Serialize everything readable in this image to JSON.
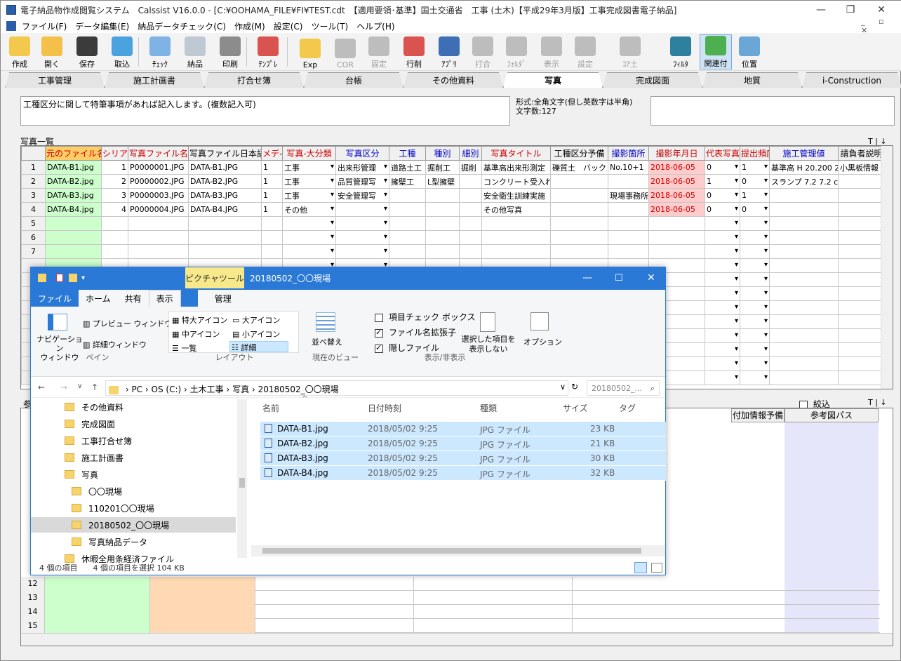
{
  "app": {
    "title": "電子納品物作成閲覧システム　Calssist V16.0.0 - [C:¥OOHAMA_FILE¥FI¥TEST.cdt　【適用要領･基準】国土交通省　工事 (土木)【平成29年3月版】工事完成図書電子納品]",
    "menu": [
      "ファイル(F)",
      "データ編集(E)",
      "納品データチェック(C)",
      "作成(M)",
      "設定(C)",
      "ツール(T)",
      "ヘルプ(H)"
    ]
  },
  "toolbar": [
    {
      "label": "作成",
      "color": "#f2c94c",
      "enabled": true
    },
    {
      "label": "開く",
      "color": "#f5c04a",
      "enabled": true
    },
    {
      "label": "保存",
      "color": "#3b3b3b",
      "enabled": true
    },
    {
      "label": "取込",
      "color": "#4aa3df",
      "enabled": true
    },
    {
      "label": "ﾁｪｯｸ",
      "color": "#7fb2e5",
      "enabled": true
    },
    {
      "label": "納品",
      "color": "#bfc9d4",
      "enabled": true
    },
    {
      "label": "印刷",
      "color": "#8c8c8c",
      "enabled": true
    },
    {
      "label": "ﾃﾝﾌﾟﾚ",
      "color": "#d9534f",
      "enabled": true
    },
    {
      "label": "Exp",
      "color": "#f2c94c",
      "enabled": true
    },
    {
      "label": "COR",
      "color": "#bdbdbd",
      "enabled": false
    },
    {
      "label": "固定",
      "color": "#bdbdbd",
      "enabled": false
    },
    {
      "label": "行削",
      "color": "#d9534f",
      "enabled": true
    },
    {
      "label": "ｱﾌﾟﾘ",
      "color": "#3e6fb5",
      "enabled": true
    },
    {
      "label": "打合",
      "color": "#bdbdbd",
      "enabled": false
    },
    {
      "label": "ﾌｫﾙﾀﾞ",
      "color": "#bdbdbd",
      "enabled": false
    },
    {
      "label": "表示",
      "color": "#bdbdbd",
      "enabled": false
    },
    {
      "label": "設定",
      "color": "#bdbdbd",
      "enabled": false
    },
    {
      "label": "ｺｱ土",
      "color": "#bdbdbd",
      "enabled": false
    },
    {
      "label": "ﾌｨﾙﾀ",
      "color": "#2f7f9e",
      "enabled": true
    },
    {
      "label": "関連付",
      "color": "#4caf50",
      "enabled": true
    },
    {
      "label": "位置",
      "color": "#6aa6d6",
      "enabled": true
    }
  ],
  "tabs": [
    "工事管理",
    "施工計画書",
    "打合せ簿",
    "台帳",
    "その他資料",
    "写真",
    "完成図面",
    "地質",
    "i-Construction"
  ],
  "selected_tab": "写真",
  "note": "工種区分に関して特筆事項があれば記入します。(複数記入可)",
  "format_hint": {
    "line1": "形式:全角文字(但し英数字は半角)",
    "line2": "文字数:127"
  },
  "photo_list": {
    "label": "写真一覧",
    "columns": [
      "元のファイル名",
      "シリアル",
      "写真ファイル名",
      "写真ファイル日本語",
      "メディ",
      "写真-大分類",
      "写真区分",
      "工種",
      "種別",
      "細別",
      "写真タイトル",
      "工種区分予備",
      "撮影箇所",
      "撮影年月日",
      "代表写真",
      "提出頻度",
      "施工管理値",
      "請負者説明"
    ],
    "rows": [
      [
        "DATA-B1.jpg",
        "1",
        "P0000001.JPG",
        "DATA-B1.JPG",
        "1",
        "工事",
        "出来形管理",
        "道路土工",
        "掘削工",
        "掘削",
        "基準高出来形測定",
        "礫質土　バック",
        "No.10+1",
        "2018-06-05",
        "0",
        "1",
        "基準高 H 20.200 2",
        "小黒板情報"
      ],
      [
        "DATA-B2.jpg",
        "2",
        "P0000002.JPG",
        "DATA-B2.JPG",
        "1",
        "工事",
        "品質管理写",
        "擁壁工",
        "L型擁壁",
        "",
        "コンクリート受入れ",
        "",
        "",
        "2018-06-05",
        "1",
        "0",
        "スランプ 7.2 7.2 cm",
        ""
      ],
      [
        "DATA-B3.jpg",
        "3",
        "P0000003.JPG",
        "DATA-B3.JPG",
        "1",
        "工事",
        "安全管理写",
        "",
        "",
        "",
        "安全衛生訓練実施",
        "",
        "現場事務所",
        "2018-06-05",
        "0",
        "1",
        "",
        ""
      ],
      [
        "DATA-B4.jpg",
        "4",
        "P0000004.JPG",
        "DATA-B4.JPG",
        "1",
        "その他",
        "",
        "",
        "",
        "",
        "その他写真",
        "",
        "",
        "2018-06-05",
        "0",
        "0",
        "",
        ""
      ]
    ],
    "row_numbers": [
      "1",
      "2",
      "3",
      "4",
      "5",
      "6",
      "7"
    ]
  },
  "ref_list": {
    "label": "参",
    "cb_label": "絞込",
    "columns": [
      "付加情報予備",
      "参考図パス"
    ],
    "row_numbers": [
      "12",
      "13",
      "14",
      "15"
    ]
  },
  "explorer": {
    "context_tab": "ピクチャツール",
    "title": "20180502_〇〇現場",
    "ribbon_tabs": [
      "ファイル",
      "ホーム",
      "共有",
      "表示",
      "管理"
    ],
    "pane_group": {
      "nav_label": "ナビゲーション",
      "nav_label2": "ウィンドウ",
      "preview": "プレビュー ウィンドウ",
      "details": "詳細ウィンドウ",
      "group": "ペイン"
    },
    "layout_group": {
      "items": [
        "特大アイコン",
        "大アイコン",
        "中アイコン",
        "小アイコン",
        "一覧",
        "詳細"
      ],
      "group": "レイアウト"
    },
    "view_group": {
      "sort": "並べ替え",
      "group": "現在のビュー"
    },
    "show_group": {
      "items": [
        "項目チェック ボックス",
        "ファイル名拡張子",
        "隠しファイル"
      ],
      "hide1": "選択した項目を",
      "hide2": "表示しない",
      "group": "表示/非表示"
    },
    "options": "オプション",
    "address": [
      "PC",
      "OS (C:)",
      "土木工事",
      "写真",
      "20180502_〇〇現場"
    ],
    "search_placeholder": "20180502_...",
    "nav_items": [
      "その他資料",
      "完成図面",
      "工事打合せ簿",
      "施工計画書",
      "写真",
      "〇〇現場",
      "110201〇〇現場",
      "20180502_〇〇現場",
      "写真納品データ",
      "休暇全用条経済ファイル"
    ],
    "list_headers": [
      "名前",
      "日付時刻",
      "種類",
      "サイズ",
      "タグ"
    ],
    "files": [
      {
        "name": "DATA-B1.jpg",
        "date": "2018/05/02 9:25",
        "type": "JPG ファイル",
        "size": "23 KB"
      },
      {
        "name": "DATA-B2.jpg",
        "date": "2018/05/02 9:25",
        "type": "JPG ファイル",
        "size": "21 KB"
      },
      {
        "name": "DATA-B3.jpg",
        "date": "2018/05/02 9:25",
        "type": "JPG ファイル",
        "size": "30 KB"
      },
      {
        "name": "DATA-B4.jpg",
        "date": "2018/05/02 9:25",
        "type": "JPG ファイル",
        "size": "32 KB"
      }
    ],
    "status": {
      "count": "4 個の項目",
      "selected": "4 個の項目を選択  104 KB"
    }
  }
}
